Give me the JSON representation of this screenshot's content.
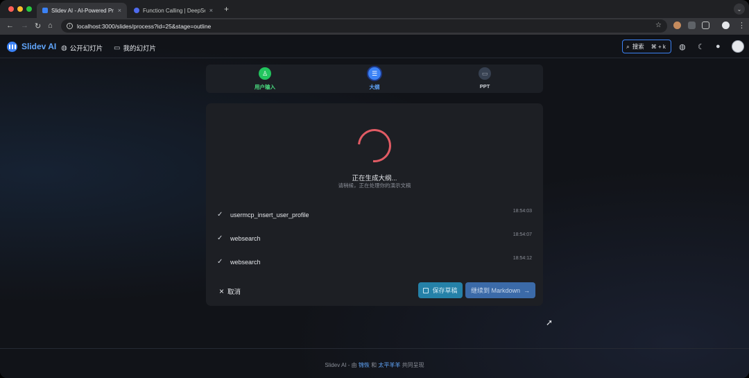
{
  "browser": {
    "tabs": [
      {
        "title": "Slidev AI - AI-Powered Prese",
        "active": true
      },
      {
        "title": "Function Calling | DeepSeek A",
        "active": false
      }
    ],
    "new_tab": "+",
    "url": "localhost:3000/slides/process?id=25&stage=outline"
  },
  "header": {
    "brand": "Slidev AI",
    "nav": [
      "公开幻灯片",
      "我的幻灯片"
    ],
    "search_label": "搜索",
    "search_shortcut": "⌘ + k"
  },
  "steps": [
    {
      "label": "用户输入",
      "state": "done",
      "color": "#22c55e"
    },
    {
      "label": "大纲",
      "state": "active",
      "color": "#3b82f6"
    },
    {
      "label": "PPT",
      "state": "pending",
      "color": "#374151"
    }
  ],
  "panel": {
    "title": "正在生成大纲...",
    "subtitle": "请稍候，正在处理你的演示文稿",
    "logs": [
      {
        "name": "usermcp_insert_user_profile",
        "time": "18:54:03"
      },
      {
        "name": "websearch",
        "time": "18:54:07"
      },
      {
        "name": "websearch",
        "time": "18:54:12"
      }
    ],
    "cancel_label": "取消",
    "save_label": "保存草稿",
    "next_label": "继续到 Markdown"
  },
  "footer": {
    "prefix": "Slidev AI - 由",
    "author1": "锦恢",
    "mid": "和",
    "author2": "太平羊羊",
    "suffix": "共同呈现"
  }
}
